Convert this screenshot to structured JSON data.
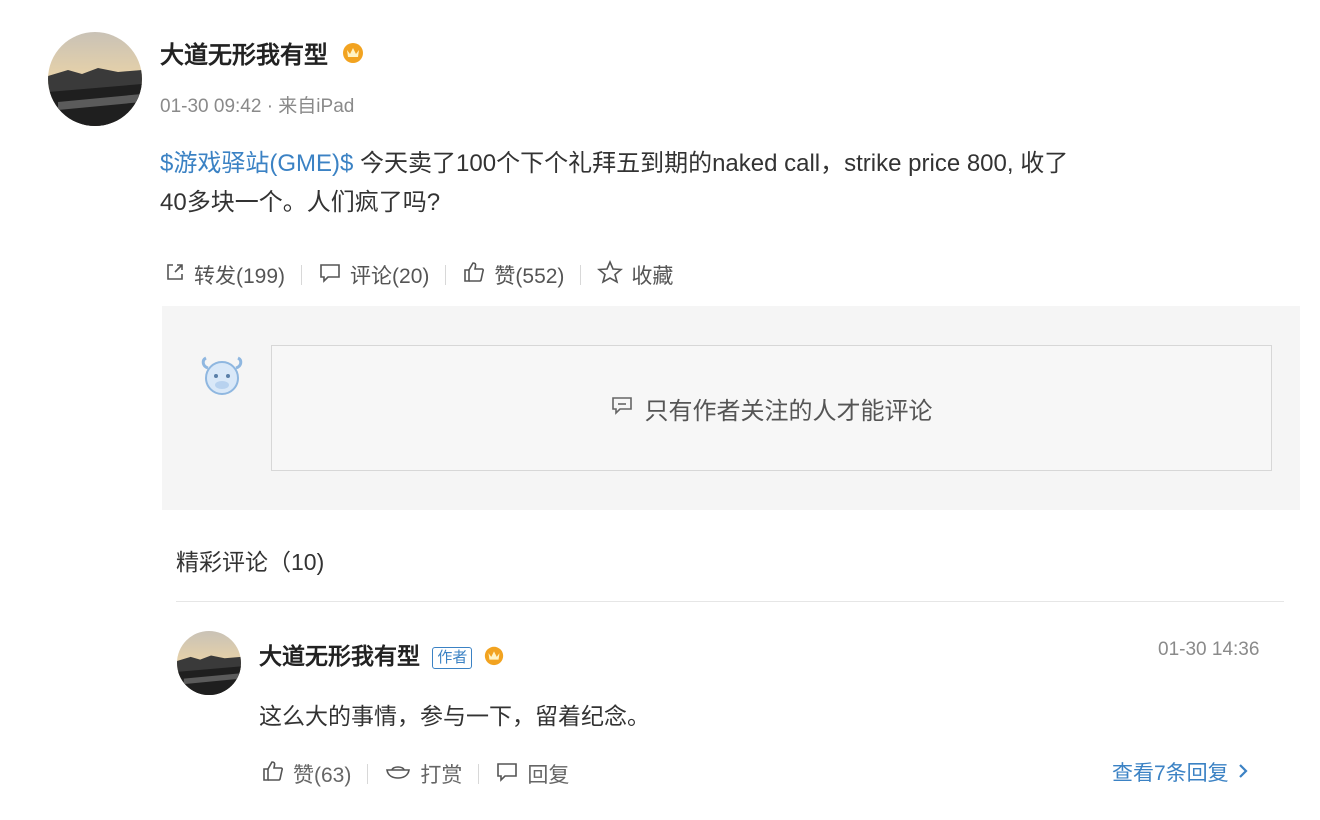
{
  "post": {
    "author": "大道无形我有型",
    "meta": "01-30 09:42 · 来自iPad",
    "stock_tag": "$游戏驿站(GME)$",
    "text_line1": " 今天卖了100个下个礼拜五到期的naked call，strike price 800, 收了",
    "text_line2": "40多块一个。人们疯了吗?",
    "actions": {
      "repost": "转发(199)",
      "comment": "评论(20)",
      "like": "赞(552)",
      "favorite": "收藏"
    }
  },
  "comment_box": {
    "notice": "只有作者关注的人才能评论"
  },
  "hot_comments": {
    "title": "精彩评论（10)",
    "items": [
      {
        "author": "大道无形我有型",
        "badge": "作者",
        "time": "01-30 14:36",
        "text": "这么大的事情，参与一下，留着纪念。",
        "like": "赞(63)",
        "tip": "打赏",
        "reply": "回复",
        "view_replies": "查看7条回复"
      }
    ]
  },
  "icons": [
    "crown-icon",
    "repost-icon",
    "comment-icon",
    "like-icon",
    "star-icon",
    "bull-mascot-icon",
    "tip-icon",
    "chevron-right-icon"
  ],
  "colors": {
    "link": "#3b82c4",
    "crown": "#f2a320",
    "panel": "#f5f5f5"
  }
}
